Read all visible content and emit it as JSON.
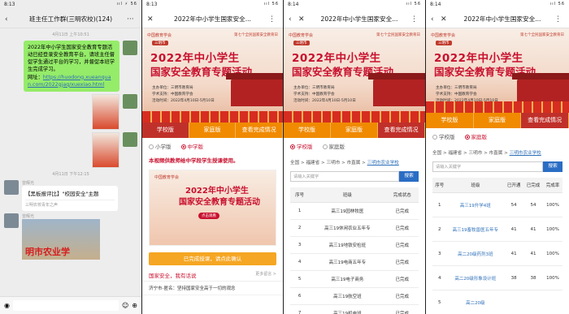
{
  "p1": {
    "time": "8:13",
    "status_right": "ııl ⚡ 56",
    "title": "班主任工作群(三明农校)(124)",
    "ts1": "4月11日 上午10:51",
    "msg1_text": "2022年中小学生国家安全教育专题活动已经登录安全教育平台，请班主任督促学生通过平台的学习，并督促本班学生完成学习。",
    "msg1_label": "网址：",
    "msg1_link": "https://huodong.xueanquan.com/2022gjaq/xuexiao.html",
    "ts2": "4月11日 下午12:15",
    "sender1": "曾辉光",
    "card_title": "【黑板报评比】\"校园安全\"主题",
    "card_source": "三明农校青年之声",
    "sender2": "曾辉光",
    "pic_text": "明市农业学",
    "voice_icon": "voice-icon",
    "emoji_icon": "emoji-icon",
    "plus_icon": "plus-icon"
  },
  "p2": {
    "time": "8:13",
    "title": "2022年中小学生国家安全...",
    "banner": {
      "logo": "中国教育学会",
      "subtitle": "第七个全民国家安全教育日",
      "tag": "三明市",
      "line1": "2022年中小学生",
      "line2": "国家安全教育专题活动",
      "info1": "主办单位：三明市教育局",
      "info2": "学术支持：中国教育学会",
      "info3": "活动时间：2022年4月10日-5月10日"
    },
    "tabs": [
      "学校版",
      "家庭版",
      "查看完成情况"
    ],
    "radio": [
      "小学版",
      "中学版"
    ],
    "note": "本视频供教师给中学段学生授课使用。",
    "bigimg": {
      "logo": "中国教育学会",
      "l1": "2022年中小学生",
      "l2": "国家安全教育专题活动",
      "btn": "点击观看"
    },
    "done_btn": "已完成授课，请点此确认",
    "section_title": "国家安全，我有话说",
    "section_more": "更多留言 >",
    "section_item": "济宁市-匿名：坚持国家安全高于一切的观念"
  },
  "p3": {
    "time": "8:14",
    "title": "2022年中小学生国家安全...",
    "tabs": [
      "学校版",
      "家庭版",
      "查看完成情况"
    ],
    "breadcrumb": [
      "全国",
      "福建省",
      "三明市",
      "市直属"
    ],
    "breadcrumb_link": "三明市农业学校",
    "search_placeholder": "请输入关键字",
    "search_btn": "搜索",
    "table": {
      "headers": [
        "序号",
        "班级",
        "完成状态"
      ],
      "rows": [
        [
          "1",
          "高三19园林牧医",
          "已完成"
        ],
        [
          "2",
          "高三19休闲农业五年专",
          "已完成"
        ],
        [
          "3",
          "高三19地铁安检班",
          "已完成"
        ],
        [
          "4",
          "高三19电商五年专",
          "已完成"
        ],
        [
          "5",
          "高三19电子商务",
          "已完成"
        ],
        [
          "6",
          "高三19航空班",
          "已完成"
        ],
        [
          "7",
          "高三19机电班",
          "已完成"
        ]
      ]
    }
  },
  "p4": {
    "time": "8:14",
    "title": "2022年中小学生国家安全...",
    "tabs": [
      "学校版",
      "家庭版",
      "查看完成情况"
    ],
    "radio": [
      "学校版",
      "家庭版"
    ],
    "breadcrumb": [
      "全国",
      "福建省",
      "三明市",
      "市直属"
    ],
    "breadcrumb_link": "三明市农业学校",
    "search_placeholder": "请输入关键字",
    "search_btn": "搜索",
    "table": {
      "headers": [
        "序号",
        "班级",
        "已开通",
        "已完成",
        "完成率"
      ],
      "rows": [
        [
          "1",
          "高三19升学4班",
          "54",
          "54",
          "100%"
        ],
        [
          "2",
          "高三19畜牧兽医五年专",
          "41",
          "41",
          "100%"
        ],
        [
          "3",
          "高二20级药剂3班",
          "41",
          "41",
          "100%"
        ],
        [
          "4",
          "高二20级形象设计班",
          "38",
          "38",
          "100%"
        ],
        [
          "5",
          "高二20级",
          "",
          "",
          ""
        ]
      ]
    }
  }
}
